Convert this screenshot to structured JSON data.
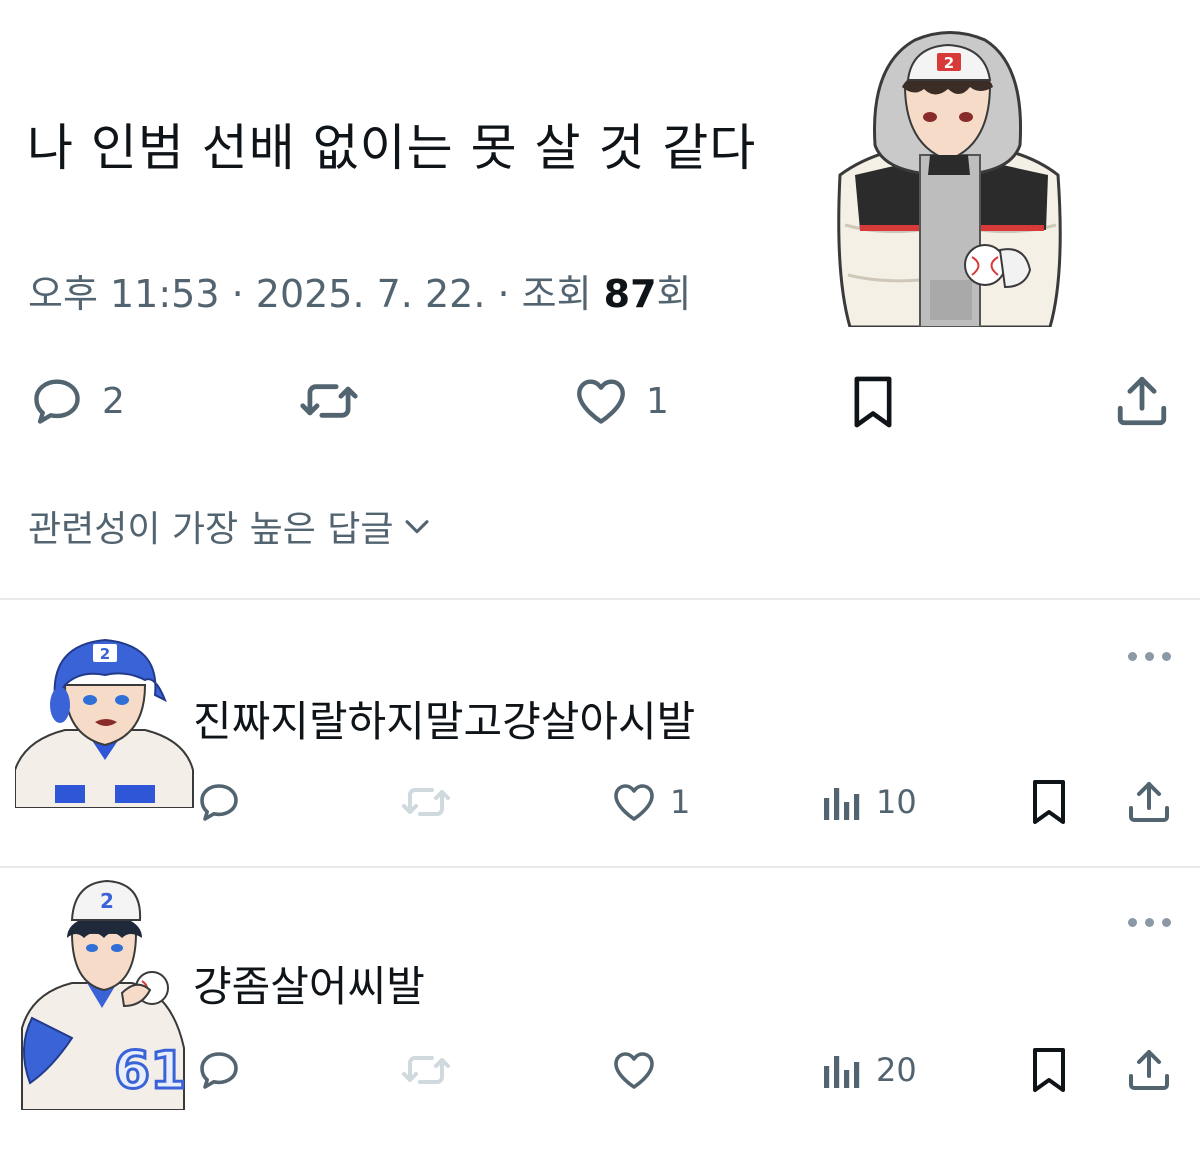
{
  "post": {
    "text": "나  인범  선배 없이는 못 살 것 같다",
    "meta": {
      "time": "오후 11:53",
      "sep1": " · ",
      "date": "2025. 7. 22.",
      "sep2": " · ",
      "views_prefix": "조회 ",
      "views_count": "87",
      "views_suffix": "회"
    },
    "actions": {
      "replies": "2",
      "likes": "1"
    }
  },
  "sort_label": "관련성이 가장 높은 답글",
  "replies": [
    {
      "text": "진짜지랄하지말고걍살아시발",
      "likes": "1",
      "views": "10"
    },
    {
      "text": "걍좀살어씨발",
      "likes": "",
      "views": "20"
    }
  ],
  "icons": {
    "reply": "speech-bubble-icon",
    "repost": "repost-arrows-icon",
    "like": "heart-icon",
    "views": "bar-chart-icon",
    "bookmark": "bookmark-icon",
    "share": "share-upload-icon",
    "more": "more-dots-icon",
    "chevron": "chevron-down-icon"
  },
  "colors": {
    "text": "#0f1419",
    "secondary": "#536471",
    "disabled": "#cfd9de",
    "divider": "#e7e9ea",
    "jersey_red": "#d83a3a",
    "jersey_blue": "#2f56d6"
  }
}
